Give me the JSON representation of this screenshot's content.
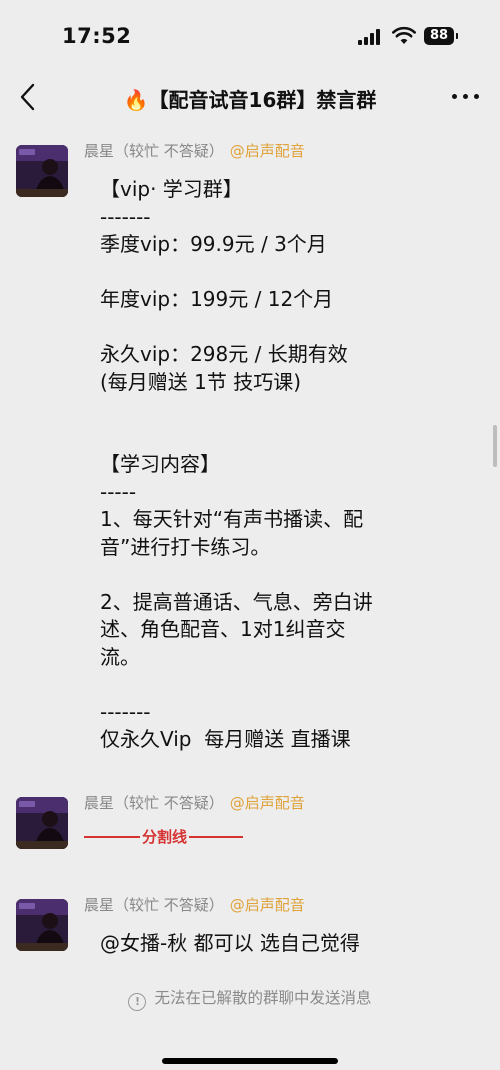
{
  "status_bar": {
    "time": "17:52",
    "battery": "88"
  },
  "nav": {
    "title": "🔥【配音试音16群】禁言群",
    "back_icon": "chevron-left-icon",
    "more_icon": "more-dots-icon"
  },
  "messages": [
    {
      "sender": "晨星（较忙 不答疑）",
      "tag": "@启声配音",
      "lines": [
        "【vip· 学习群】",
        "-------",
        "季度vip：99.9元 / 3个月",
        "",
        "年度vip：199元 / 12个月",
        "",
        "永久vip：298元 / 长期有效",
        "(每月赠送 1节 技巧课)",
        "",
        "",
        "【学习内容】",
        "-----",
        "1、每天针对“有声书播读、配",
        "音”进行打卡练习。",
        "",
        "2、提高普通话、气息、旁白讲",
        "述、角色配音、1对1纠音交",
        "流。",
        "",
        "-------",
        "仅永久Vip  每月赠送 直播课"
      ]
    },
    {
      "sender": "晨星（较忙 不答疑）",
      "tag": "@启声配音",
      "divider_label": "分割线"
    },
    {
      "sender": "晨星（较忙 不答疑）",
      "tag": "@启声配音",
      "text": "@女播-秋 都可以 选自己觉得"
    }
  ],
  "notice": "无法在已解散的群聊中发送消息",
  "colors": {
    "background": "#ededed",
    "tag": "#e0a23a",
    "divider": "#d63333"
  }
}
